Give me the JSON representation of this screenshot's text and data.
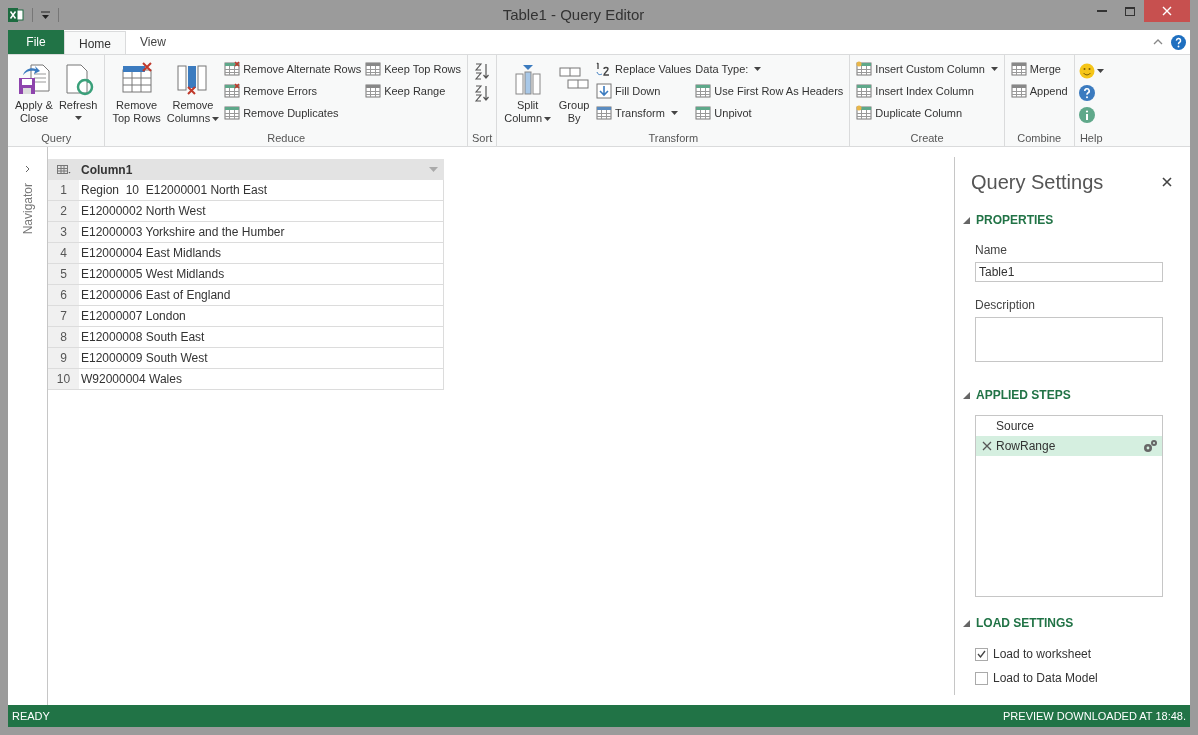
{
  "window": {
    "title": "Table1 - Query Editor"
  },
  "tabs": [
    {
      "label": "File",
      "kind": "file",
      "selected": false
    },
    {
      "label": "Home",
      "kind": "tab",
      "selected": true
    },
    {
      "label": "View",
      "kind": "tab",
      "selected": false
    }
  ],
  "ribbon": {
    "groups": [
      {
        "label": "Query",
        "kind": "buttons",
        "large": [
          {
            "lines": [
              "Apply &",
              "Close"
            ],
            "dropdown": false
          },
          {
            "lines": [
              "Refresh"
            ],
            "dropdown": true
          }
        ]
      },
      {
        "label": "Reduce",
        "kind": "buttons",
        "large": [
          {
            "lines": [
              "Remove",
              "Top Rows"
            ],
            "dropdown": false
          },
          {
            "lines": [
              "Remove",
              "Columns"
            ],
            "dropdown": true
          }
        ],
        "small_columns": [
          [
            {
              "label": "Remove Alternate Rows",
              "dropdown": false
            },
            {
              "label": "Remove Errors",
              "dropdown": false
            },
            {
              "label": "Remove Duplicates",
              "dropdown": false
            }
          ],
          [
            {
              "label": "Keep Top Rows",
              "dropdown": false
            },
            {
              "label": "Keep Range",
              "dropdown": false
            }
          ]
        ]
      },
      {
        "label": "Sort",
        "kind": "sort"
      },
      {
        "label": "Transform",
        "kind": "buttons",
        "large": [
          {
            "lines": [
              "Split",
              "Column"
            ],
            "dropdown": true
          },
          {
            "lines": [
              "Group",
              "By"
            ],
            "dropdown": false
          }
        ],
        "small_columns": [
          [
            {
              "label": "Replace Values",
              "dropdown": false
            },
            {
              "label": "Fill Down",
              "dropdown": false
            },
            {
              "label": "Transform",
              "dropdown": true
            }
          ],
          [
            {
              "label": "Data Type:",
              "dropdown": true
            },
            {
              "label": "Use First Row As Headers",
              "dropdown": false
            },
            {
              "label": "Unpivot",
              "dropdown": false
            }
          ]
        ]
      },
      {
        "label": "Create",
        "kind": "buttons",
        "small_columns": [
          [
            {
              "label": "Insert Custom Column",
              "dropdown": true
            },
            {
              "label": "Insert Index Column",
              "dropdown": false
            },
            {
              "label": "Duplicate Column",
              "dropdown": false
            }
          ]
        ]
      },
      {
        "label": "Combine",
        "kind": "buttons",
        "small_columns": [
          [
            {
              "label": "Merge",
              "dropdown": false
            },
            {
              "label": "Append",
              "dropdown": false
            }
          ]
        ]
      },
      {
        "label": "Help",
        "kind": "help",
        "items": [
          {
            "dropdown": true
          },
          {
            "dropdown": false
          },
          {
            "dropdown": false
          }
        ]
      }
    ]
  },
  "navigator": {
    "label": "Navigator",
    "expanded": false
  },
  "table": {
    "columns": [
      "Column1"
    ],
    "rows": [
      {
        "number": "1",
        "cells": [
          "Region  10  E12000001 North East"
        ]
      },
      {
        "number": "2",
        "cells": [
          "E12000002 North West"
        ]
      },
      {
        "number": "3",
        "cells": [
          "E12000003 Yorkshire and the Humber"
        ]
      },
      {
        "number": "4",
        "cells": [
          "E12000004 East Midlands"
        ]
      },
      {
        "number": "5",
        "cells": [
          "E12000005 West Midlands"
        ]
      },
      {
        "number": "6",
        "cells": [
          "E12000006 East of England"
        ]
      },
      {
        "number": "7",
        "cells": [
          "E12000007 London"
        ]
      },
      {
        "number": "8",
        "cells": [
          "E12000008 South East"
        ]
      },
      {
        "number": "9",
        "cells": [
          "E12000009 South West"
        ]
      },
      {
        "number": "10",
        "cells": [
          "W92000004 Wales"
        ]
      }
    ]
  },
  "query_settings": {
    "title": "Query Settings",
    "properties": {
      "heading": "PROPERTIES",
      "expanded": true,
      "name_label": "Name",
      "name_value": "Table1",
      "description_label": "Description"
    },
    "applied_steps": {
      "heading": "APPLIED STEPS",
      "expanded": true,
      "steps": [
        {
          "label": "Source",
          "selected": false
        },
        {
          "label": "RowRange",
          "selected": true
        }
      ]
    },
    "load_settings": {
      "heading": "LOAD SETTINGS",
      "expanded": true,
      "options": [
        {
          "label": "Load to worksheet",
          "checked": true
        },
        {
          "label": "Load to Data Model",
          "checked": false
        }
      ]
    }
  },
  "status_bar": {
    "left": "READY",
    "right": "PREVIEW DOWNLOADED AT 18:48."
  }
}
